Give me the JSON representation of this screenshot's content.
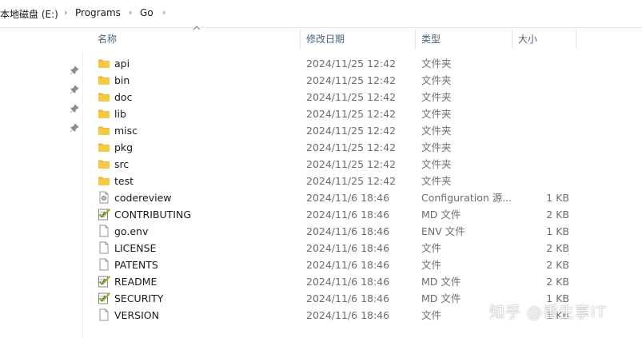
{
  "breadcrumb": {
    "items": [
      "本地磁盘 (E:)",
      "Programs",
      "Go"
    ],
    "separator": "›"
  },
  "columns": {
    "name": "名称",
    "date": "修改日期",
    "type": "类型",
    "size": "大小"
  },
  "files": [
    {
      "name": "api",
      "date": "2024/11/25 12:42",
      "type": "文件夹",
      "size": "",
      "icon": "folder-icon"
    },
    {
      "name": "bin",
      "date": "2024/11/25 12:42",
      "type": "文件夹",
      "size": "",
      "icon": "folder-icon"
    },
    {
      "name": "doc",
      "date": "2024/11/25 12:42",
      "type": "文件夹",
      "size": "",
      "icon": "folder-icon"
    },
    {
      "name": "lib",
      "date": "2024/11/25 12:42",
      "type": "文件夹",
      "size": "",
      "icon": "folder-icon"
    },
    {
      "name": "misc",
      "date": "2024/11/25 12:42",
      "type": "文件夹",
      "size": "",
      "icon": "folder-icon"
    },
    {
      "name": "pkg",
      "date": "2024/11/25 12:42",
      "type": "文件夹",
      "size": "",
      "icon": "folder-icon"
    },
    {
      "name": "src",
      "date": "2024/11/25 12:42",
      "type": "文件夹",
      "size": "",
      "icon": "folder-icon"
    },
    {
      "name": "test",
      "date": "2024/11/25 12:42",
      "type": "文件夹",
      "size": "",
      "icon": "folder-icon"
    },
    {
      "name": "codereview",
      "date": "2024/11/6 18:46",
      "type": "Configuration 源...",
      "size": "1 KB",
      "icon": "config-file-icon"
    },
    {
      "name": "CONTRIBUTING",
      "date": "2024/11/6 18:46",
      "type": "MD 文件",
      "size": "2 KB",
      "icon": "markdown-file-icon"
    },
    {
      "name": "go.env",
      "date": "2024/11/6 18:46",
      "type": "ENV 文件",
      "size": "1 KB",
      "icon": "blank-file-icon"
    },
    {
      "name": "LICENSE",
      "date": "2024/11/6 18:46",
      "type": "文件",
      "size": "2 KB",
      "icon": "blank-file-icon"
    },
    {
      "name": "PATENTS",
      "date": "2024/11/6 18:46",
      "type": "文件",
      "size": "2 KB",
      "icon": "blank-file-icon"
    },
    {
      "name": "README",
      "date": "2024/11/6 18:46",
      "type": "MD 文件",
      "size": "2 KB",
      "icon": "markdown-file-icon"
    },
    {
      "name": "SECURITY",
      "date": "2024/11/6 18:46",
      "type": "MD 文件",
      "size": "1 KB",
      "icon": "markdown-file-icon"
    },
    {
      "name": "VERSION",
      "date": "2024/11/6 18:46",
      "type": "文件",
      "size": "1 KB",
      "icon": "blank-file-icon"
    }
  ],
  "pins": [
    "pin-icon",
    "pin-icon",
    "pin-icon",
    "pin-icon"
  ],
  "watermark": "知乎 @香生享IT",
  "colors": {
    "header_text": "#4c607a",
    "folder": "#f7c843",
    "muted_text": "#6d6d6d"
  }
}
